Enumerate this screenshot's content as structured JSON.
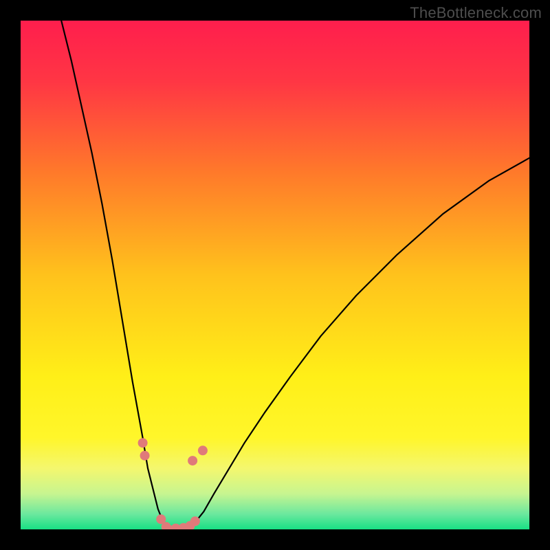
{
  "watermark": "TheBottleneck.com",
  "chart_data": {
    "type": "line",
    "title": "",
    "xlabel": "",
    "ylabel": "",
    "xlim": [
      0,
      100
    ],
    "ylim": [
      0,
      100
    ],
    "grid": false,
    "legend": false,
    "background_gradient_stops": [
      {
        "offset": 0.0,
        "color": "#ff1e4d"
      },
      {
        "offset": 0.12,
        "color": "#ff3644"
      },
      {
        "offset": 0.3,
        "color": "#ff7a2a"
      },
      {
        "offset": 0.5,
        "color": "#ffc21c"
      },
      {
        "offset": 0.7,
        "color": "#ffef18"
      },
      {
        "offset": 0.82,
        "color": "#fff62a"
      },
      {
        "offset": 0.88,
        "color": "#f4f76e"
      },
      {
        "offset": 0.93,
        "color": "#c7f590"
      },
      {
        "offset": 0.97,
        "color": "#6be89e"
      },
      {
        "offset": 1.0,
        "color": "#18df84"
      }
    ],
    "series": [
      {
        "name": "left-curve",
        "stroke": "#000000",
        "x": [
          8,
          10,
          12,
          14,
          16,
          18,
          20,
          22,
          24,
          25,
          26,
          27,
          28,
          28.8
        ],
        "y": [
          100,
          92,
          83,
          74,
          64,
          53,
          41,
          29,
          18,
          12,
          8,
          4,
          1.5,
          0
        ]
      },
      {
        "name": "right-curve",
        "stroke": "#000000",
        "x": [
          33.3,
          34,
          36,
          38,
          41,
          44,
          48,
          53,
          59,
          66,
          74,
          83,
          92,
          100
        ],
        "y": [
          0,
          1,
          3.5,
          7,
          12,
          17,
          23,
          30,
          38,
          46,
          54,
          62,
          68.5,
          73
        ]
      },
      {
        "name": "trough-floor",
        "stroke": "#e07a7a",
        "x": [
          28.5,
          29.5,
          30.5,
          31.5,
          32.5,
          33.4
        ],
        "y": [
          0.4,
          0.1,
          0.0,
          0.0,
          0.1,
          0.4
        ]
      }
    ],
    "markers": [
      {
        "x": 24.0,
        "y": 17.0,
        "r": 7,
        "fill": "#e07a7a"
      },
      {
        "x": 24.4,
        "y": 14.5,
        "r": 7,
        "fill": "#e07a7a"
      },
      {
        "x": 27.6,
        "y": 2.0,
        "r": 7,
        "fill": "#e07a7a"
      },
      {
        "x": 28.6,
        "y": 0.5,
        "r": 7,
        "fill": "#e07a7a"
      },
      {
        "x": 30.5,
        "y": 0.2,
        "r": 7,
        "fill": "#e07a7a"
      },
      {
        "x": 32.0,
        "y": 0.3,
        "r": 7,
        "fill": "#e07a7a"
      },
      {
        "x": 33.3,
        "y": 0.7,
        "r": 7,
        "fill": "#e07a7a"
      },
      {
        "x": 34.3,
        "y": 1.6,
        "r": 7,
        "fill": "#e07a7a"
      },
      {
        "x": 33.8,
        "y": 13.5,
        "r": 7,
        "fill": "#e07a7a"
      },
      {
        "x": 35.8,
        "y": 15.5,
        "r": 7,
        "fill": "#e07a7a"
      }
    ]
  }
}
